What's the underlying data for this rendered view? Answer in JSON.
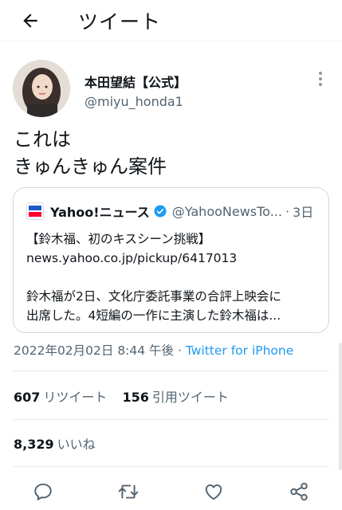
{
  "header": {
    "title": "ツイート",
    "back_icon": "arrow-left-icon"
  },
  "author": {
    "name": "本田望結【公式】",
    "handle": "@miyu_honda1"
  },
  "tweet": {
    "text": "これは\nきゅんきゅん案件"
  },
  "quote": {
    "source_icon": "yahoo-news-logo",
    "name": "Yahoo!ニュース",
    "handle": "@YahooNewsTo...",
    "separator": "·",
    "time": "3日",
    "body_line1": "【鈴木福、初のキスシーン挑戦】",
    "body_line2": "news.yahoo.co.jp/pickup/6417013",
    "body_line3": "鈴木福が2日、文化庁委託事業の合評上映会に",
    "body_line4": "出席した。4短編の一作に主演した鈴木福は..."
  },
  "meta": {
    "timestamp": "2022年02月02日 8:44 午後 · ",
    "source": "Twitter for iPhone"
  },
  "stats": {
    "retweets_count": "607",
    "retweets_label": "リツイート",
    "quotes_count": "156",
    "quotes_label": "引用ツイート",
    "likes_count": "8,329",
    "likes_label": "いいね"
  },
  "actions": [
    "reply-icon",
    "retweet-icon",
    "like-icon",
    "share-icon"
  ],
  "colors": {
    "link": "#1d9bf0",
    "secondary_text": "#536471",
    "primary_text": "#0f1419",
    "verified": "#1d9bf0"
  }
}
